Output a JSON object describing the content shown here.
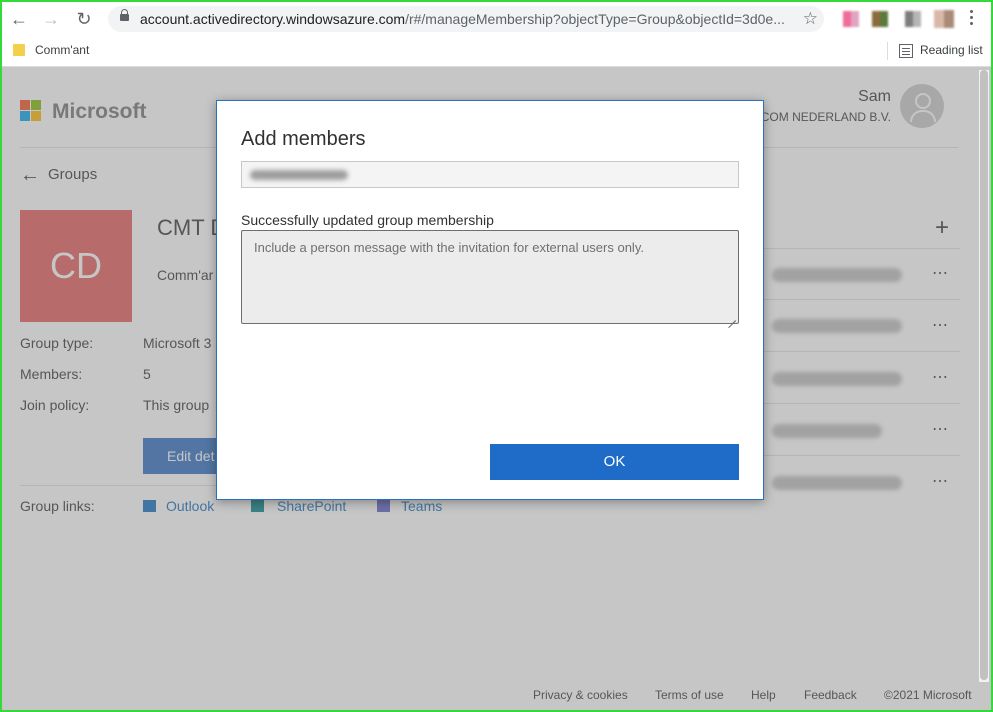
{
  "browser": {
    "url_host": "account.activedirectory.windowsazure.com",
    "url_path": "/r#/manageMembership?objectType=Group&objectId=3d0e...",
    "bookmark_label": "Comm'ant",
    "reading_list_label": "Reading list"
  },
  "header": {
    "brand": "Microsoft",
    "user_name": "Sam",
    "user_org": "COM NEDERLAND B.V."
  },
  "page": {
    "back_label": "Groups",
    "tile_initials": "CD",
    "group_title": "CMT D",
    "group_subtitle": "Comm'ar",
    "props": [
      {
        "label": "Group type:",
        "value": "Microsoft 3"
      },
      {
        "label": "Members:",
        "value": "5"
      },
      {
        "label": "Join policy:",
        "value": "This group"
      }
    ],
    "edit_label": "Edit det",
    "links_label": "Group links:",
    "links": [
      "Outlook",
      "SharePoint",
      "Teams"
    ]
  },
  "footer": {
    "links": [
      "Privacy & cookies",
      "Terms of use",
      "Help",
      "Feedback",
      "©2021 Microsoft"
    ]
  },
  "modal": {
    "title": "Add members",
    "status_message": "Successfully updated group membership",
    "textarea_placeholder": "Include a person message with the invitation for external users only.",
    "ok_label": "OK"
  },
  "colors": {
    "accent": "#1e6bc8",
    "tile": "#e35a5a",
    "border_highlight": "#34d93a"
  }
}
